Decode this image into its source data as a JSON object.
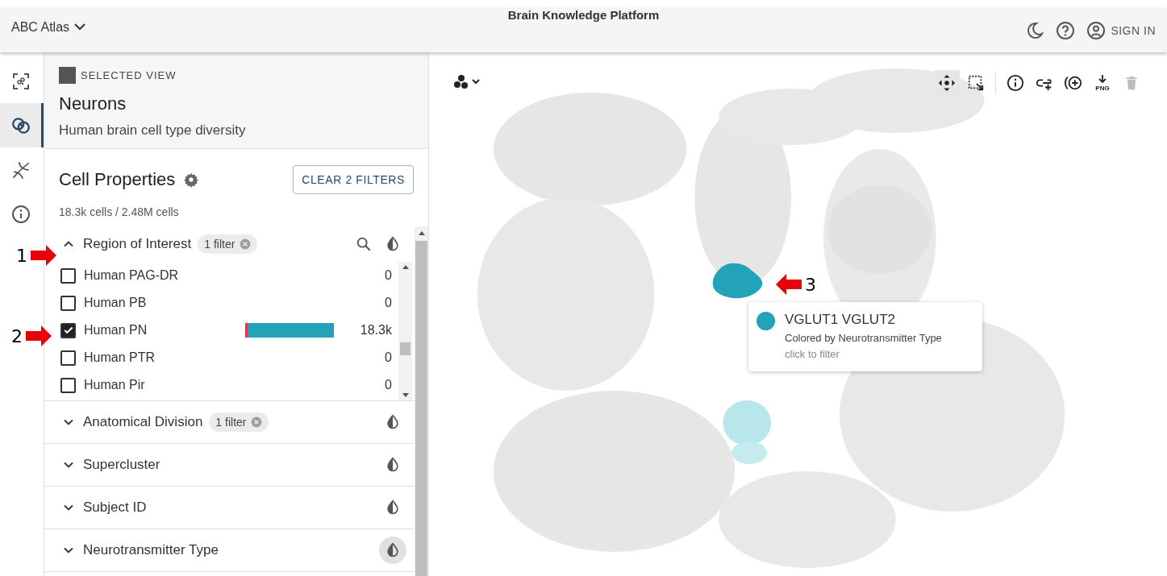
{
  "header": {
    "app_menu": "ABC Atlas",
    "title": "Brain Knowledge Platform",
    "sign_in": "SIGN IN"
  },
  "rail": [
    {
      "kind": "scatter",
      "selected": false
    },
    {
      "kind": "views",
      "selected": true
    },
    {
      "kind": "dna",
      "selected": false
    },
    {
      "kind": "info",
      "selected": false
    }
  ],
  "selected_view": {
    "label": "SELECTED VIEW",
    "title": "Neurons",
    "subtitle": "Human brain cell type diversity"
  },
  "cell_properties": {
    "title": "Cell Properties",
    "clear_button": "CLEAR 2 FILTERS",
    "counts": "18.3k cells / 2.48M cells"
  },
  "sections": [
    {
      "title": "Region of Interest",
      "expanded": true,
      "badge": "1 filter",
      "search": true,
      "color_by": false,
      "items": [
        {
          "label": "Human PAG-DR",
          "checked": false,
          "count": "0"
        },
        {
          "label": "Human PB",
          "checked": false,
          "count": "0"
        },
        {
          "label": "Human PN",
          "checked": true,
          "count": "18.3k"
        },
        {
          "label": "Human PTR",
          "checked": false,
          "count": "0"
        },
        {
          "label": "Human Pir",
          "checked": false,
          "count": "0"
        }
      ]
    },
    {
      "title": "Anatomical Division",
      "expanded": false,
      "badge": "1 filter",
      "color_by": false
    },
    {
      "title": "Supercluster",
      "expanded": false,
      "color_by": false
    },
    {
      "title": "Subject ID",
      "expanded": false,
      "color_by": false
    },
    {
      "title": "Neurotransmitter Type",
      "expanded": false,
      "color_by": true
    }
  ],
  "tooltip": {
    "title": "VGLUT1 VGLUT2",
    "color": "#22a3b8",
    "subtitle": "Colored by Neurotransmitter Type",
    "hint": "click to filter"
  },
  "toolbar": [
    {
      "kind": "pan",
      "selected": true
    },
    {
      "kind": "select",
      "selected": false
    },
    {
      "kind": "info",
      "selected": false
    },
    {
      "kind": "link",
      "selected": false
    },
    {
      "kind": "add",
      "selected": false
    },
    {
      "kind": "png",
      "label": "PNG",
      "selected": false
    },
    {
      "kind": "delete",
      "selected": false
    }
  ],
  "callouts": [
    {
      "label": "1"
    },
    {
      "label": "2"
    },
    {
      "label": "3"
    }
  ]
}
